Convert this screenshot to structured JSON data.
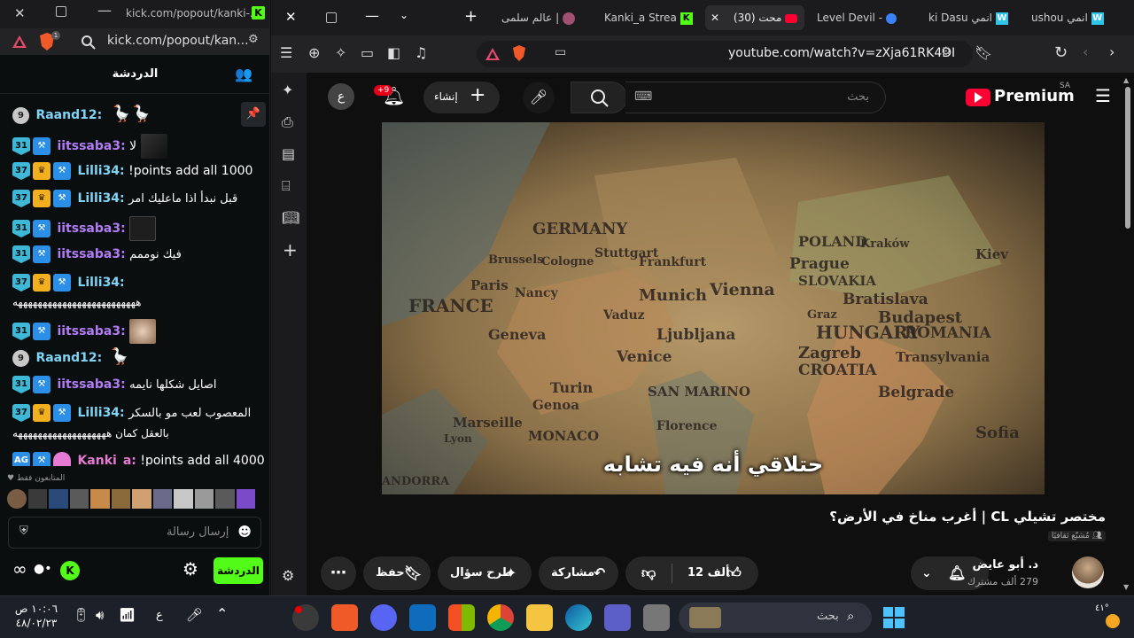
{
  "left_window": {
    "title": "kick.com/popout/kanki-...",
    "address": "kick.com/popout/kan...",
    "chat_title": "الدردشة",
    "messages": [
      {
        "num": "9",
        "user": "Raand12:",
        "color": "teal",
        "text": ""
      },
      {
        "sub": "31",
        "user": "iitssaba3:",
        "color": "purple",
        "text": "لا"
      },
      {
        "sub": "37",
        "user": "Lilli34:",
        "color": "teal",
        "text": "!points add all 1000"
      },
      {
        "sub": "37",
        "user": "Lilli34:",
        "color": "teal",
        "text": "قبل نبدأ اذا ماعليك امر"
      },
      {
        "sub": "31",
        "user": "iitssaba3:",
        "color": "purple",
        "text": ""
      },
      {
        "sub": "31",
        "user": "iitssaba3:",
        "color": "purple",
        "text": "فيك نوممم"
      },
      {
        "sub": "37",
        "user": "Lilli34:",
        "color": "teal",
        "text": ""
      },
      {
        "text": "هههههههههههههههههههههههههه"
      },
      {
        "sub": "31",
        "user": "iitssaba3:",
        "color": "purple",
        "text": ""
      },
      {
        "num": "9",
        "user": "Raand12:",
        "color": "teal",
        "text": ""
      },
      {
        "sub": "31",
        "user": "iitssaba3:",
        "color": "purple",
        "text": "اصايل شكلها نايمه"
      },
      {
        "sub": "37",
        "user": "Lilli34:",
        "color": "teal",
        "text": "المعصوب لعب مو بالسكر"
      },
      {
        "text": "بالعقل كمان هههههههههههههههههههه"
      },
      {
        "sub": "AG",
        "user": "Kanki_a:",
        "color": "pink",
        "text": "!points add all 4000"
      }
    ],
    "followers_only": "المتابعون فقط",
    "input_placeholder": "إرسال رسالة",
    "chat_button": "الدردشة"
  },
  "right_window": {
    "tabs": [
      {
        "label": "عالم سلمى |"
      },
      {
        "label": "Kanki_a Strea"
      },
      {
        "label": "(30) محت"
      },
      {
        "label": "Level Devil -"
      },
      {
        "label": "ki Dasu انمي"
      },
      {
        "label": "ushou انمي"
      }
    ],
    "url": "youtube.com/watch?v=zXja61RK4DI",
    "youtube": {
      "brand": "Premium",
      "region": "SA",
      "search_placeholder": "بحث",
      "create_label": "إنشاء",
      "notif_badge": "+9",
      "avatar_letter": "ع"
    },
    "video": {
      "subtitle": "حتلاقي أنه فيه تشابه",
      "title": "مختصر تشيلي CL | أغرب مناخ في الأرض؟",
      "tag": "مُشبّع ثقافيًا",
      "channel": "د. أبو عايض",
      "subs": "279 ألف مشترك",
      "likes": "12 ألف",
      "share": "مشاركة",
      "ask": "طرح سؤال",
      "save": "حفظ"
    },
    "map_labels": [
      "GERMANY",
      "Cologne",
      "Frankfurt",
      "Munich",
      "Vienna",
      "Prague",
      "POLAND",
      "SLOVAKIA",
      "HUNGARY",
      "Budapest",
      "ROMANIA",
      "Bratislava",
      "FRANCE",
      "Paris",
      "Nancy",
      "Geneva",
      "Vaduz",
      "Ljubljana",
      "Venice",
      "Zagreb",
      "CROATIA",
      "Belgrade",
      "Turin",
      "Genoa",
      "MONACO",
      "Florence",
      "SAN MARINO",
      "Marseille",
      "Sofia",
      "Stuttgart",
      "Brussels",
      "Transylvania",
      "Lyon",
      "ANDORRA",
      "Graz",
      "Kraków",
      "Kiev"
    ]
  },
  "taskbar": {
    "time": "١٠:٠٦ ص",
    "date": "٤٨/٠٢/٢٣",
    "lang": "ع",
    "search": "بحث",
    "temp": "٤١°"
  }
}
